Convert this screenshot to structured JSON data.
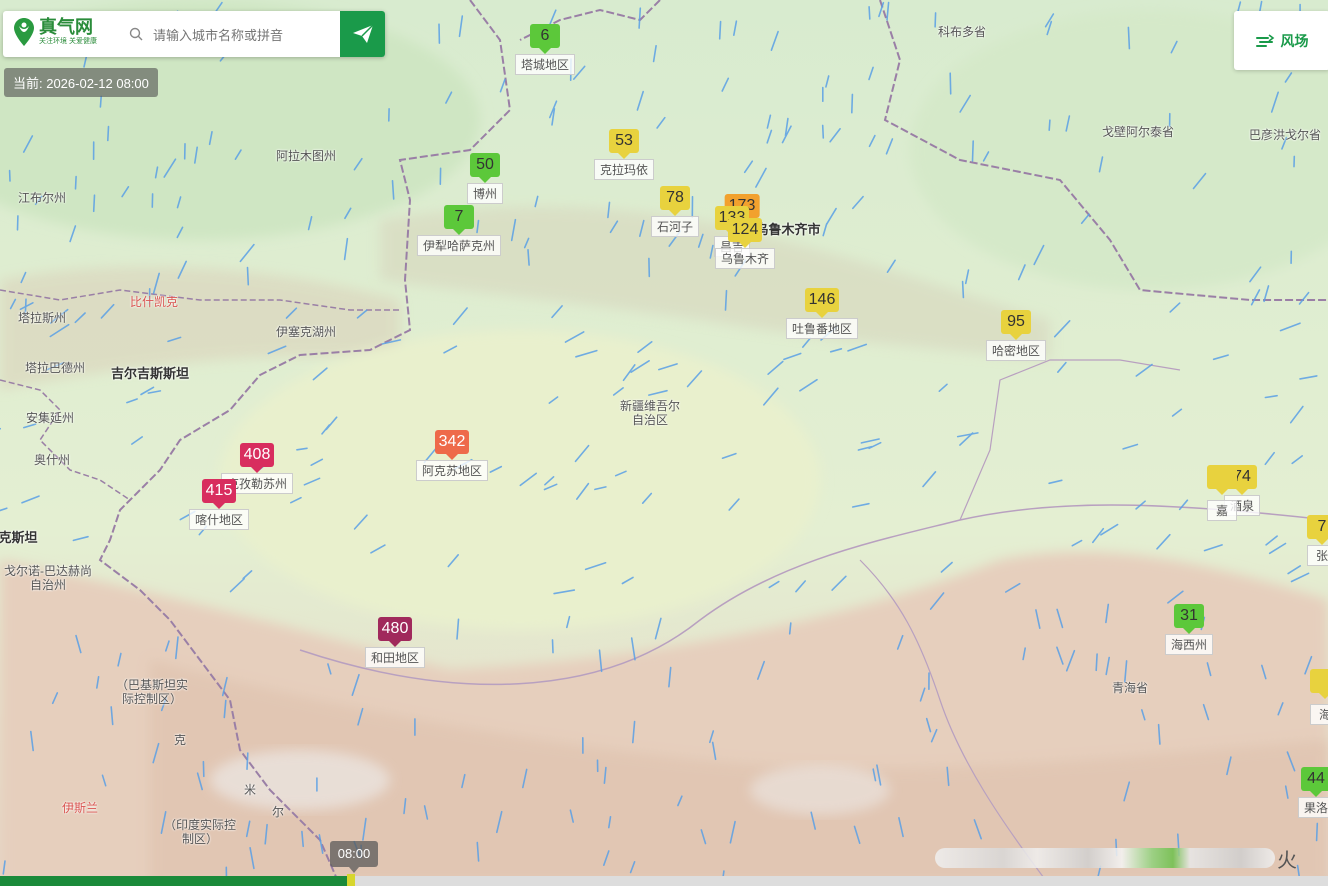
{
  "search": {
    "logo_name": "真气网",
    "logo_sub": "关注环境 关爱健康",
    "placeholder": "请输入城市名称或拼音"
  },
  "current_time": "当前: 2026-02-12 08:00",
  "wind_button_label": "风场",
  "timeline": {
    "handle_label": "08:00",
    "progress_fraction": 0.265
  },
  "legend_end_text": "火",
  "colors": {
    "brand": "#1a9a4a",
    "aqi_good": "#5cc83a",
    "aqi_moderate": "#e8d23e",
    "aqi_unhealthy_sensitive": "#f2a12e",
    "aqi_very_unhealthy": "#ee6a4a",
    "aqi_hazardous": "#d82d5e",
    "aqi_severe": "#a0295c"
  },
  "places": [
    {
      "text": "科布多省",
      "cls": ""
    },
    {
      "text": "戈壁阿尔泰省",
      "cls": ""
    },
    {
      "text": "巴彦洪戈尔省",
      "cls": ""
    },
    {
      "text": "阿拉木图州",
      "cls": ""
    },
    {
      "text": "江布尔州",
      "cls": ""
    },
    {
      "text": "比什凯克",
      "cls": "red"
    },
    {
      "text": "塔拉斯州",
      "cls": ""
    },
    {
      "text": "伊塞克湖州",
      "cls": ""
    },
    {
      "text": "塔拉巴德州",
      "cls": ""
    },
    {
      "text": "吉尔吉斯斯坦",
      "cls": "big"
    },
    {
      "text": "安集延州",
      "cls": ""
    },
    {
      "text": "奥什州",
      "cls": ""
    },
    {
      "text": "克斯坦",
      "cls": "big"
    },
    {
      "text": "戈尔诺-巴达赫尚自治州",
      "cls": ""
    },
    {
      "text": "（巴基斯坦实际控制区）",
      "cls": ""
    },
    {
      "text": "克",
      "cls": ""
    },
    {
      "text": "伊斯兰",
      "cls": "red"
    },
    {
      "text": "（印度实际控制区）",
      "cls": ""
    },
    {
      "text": "米",
      "cls": ""
    },
    {
      "text": "尔",
      "cls": ""
    },
    {
      "text": "乌鲁木齐市",
      "cls": "big"
    },
    {
      "text": "新疆维吾尔自治区",
      "cls": ""
    },
    {
      "text": "青海省",
      "cls": ""
    }
  ],
  "stations": [
    {
      "value": "6",
      "label": "塔城地区",
      "color": "#5cc83a",
      "text_color": "#333"
    },
    {
      "value": "53",
      "label": "克拉玛依",
      "color": "#e8d23e",
      "text_color": "#333"
    },
    {
      "value": "50",
      "label": "博州",
      "color": "#5cc83a",
      "text_color": "#333"
    },
    {
      "value": "7",
      "label": "伊犁哈萨克州",
      "color": "#5cc83a",
      "text_color": "#333"
    },
    {
      "value": "78",
      "label": "石河子",
      "color": "#e8d23e",
      "text_color": "#333"
    },
    {
      "value": "173",
      "label": "",
      "color": "#f2a12e",
      "text_color": "#333"
    },
    {
      "value": "133",
      "label": "昌吉",
      "color": "#e8d23e",
      "text_color": "#333"
    },
    {
      "value": "124",
      "label": "乌鲁木齐",
      "color": "#e8d23e",
      "text_color": "#333"
    },
    {
      "value": "146",
      "label": "吐鲁番地区",
      "color": "#e8d23e",
      "text_color": "#333"
    },
    {
      "value": "95",
      "label": "哈密地区",
      "color": "#e8d23e",
      "text_color": "#333"
    },
    {
      "value": "408",
      "label": "克孜勒苏州",
      "color": "#d82d5e",
      "text_color": "#fff"
    },
    {
      "value": "415",
      "label": "喀什地区",
      "color": "#d82d5e",
      "text_color": "#fff"
    },
    {
      "value": "342",
      "label": "阿克苏地区",
      "color": "#ee6a4a",
      "text_color": "#fff"
    },
    {
      "value": "480",
      "label": "和田地区",
      "color": "#a0295c",
      "text_color": "#fff"
    },
    {
      "value": "74",
      "label": "酒泉",
      "color": "#e8d23e",
      "text_color": "#333"
    },
    {
      "value": "",
      "label": "嘉",
      "color": "#e8d23e",
      "text_color": "#333"
    },
    {
      "value": "7",
      "label": "张",
      "color": "#e8d23e",
      "text_color": "#333"
    },
    {
      "value": "31",
      "label": "海西州",
      "color": "#5cc83a",
      "text_color": "#333"
    },
    {
      "value": "",
      "label": "海",
      "color": "#e8d23e",
      "text_color": "#333"
    },
    {
      "value": "44",
      "label": "果洛",
      "color": "#5cc83a",
      "text_color": "#333"
    }
  ]
}
